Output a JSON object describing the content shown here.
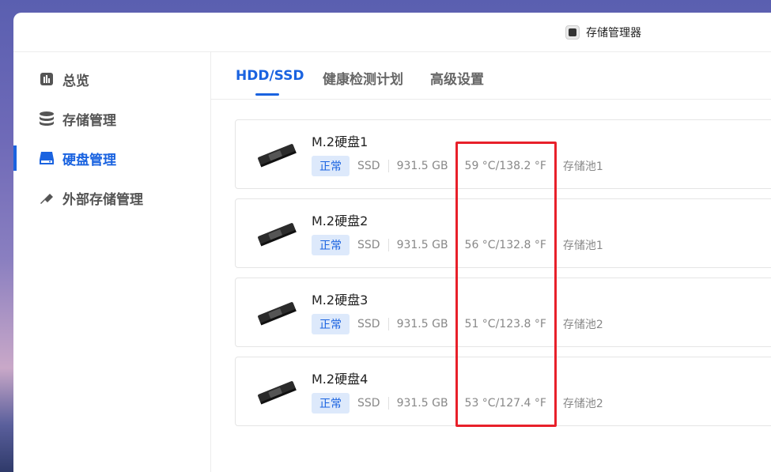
{
  "app": {
    "title": "存储管理器"
  },
  "sidebar": {
    "items": [
      {
        "label": "总览",
        "icon": "chart-icon"
      },
      {
        "label": "存储管理",
        "icon": "database-icon"
      },
      {
        "label": "硬盘管理",
        "icon": "drive-icon",
        "active": true
      },
      {
        "label": "外部存储管理",
        "icon": "usb-icon"
      }
    ]
  },
  "tabs": [
    {
      "label": "HDD/SSD",
      "active": true
    },
    {
      "label": "健康检测计划"
    },
    {
      "label": "高级设置"
    }
  ],
  "disks": [
    {
      "name": "M.2硬盘1",
      "status": "正常",
      "type": "SSD",
      "size": "931.5 GB",
      "temp": "59 °C/138.2 °F",
      "pool": "存储池1"
    },
    {
      "name": "M.2硬盘2",
      "status": "正常",
      "type": "SSD",
      "size": "931.5 GB",
      "temp": "56 °C/132.8 °F",
      "pool": "存储池1"
    },
    {
      "name": "M.2硬盘3",
      "status": "正常",
      "type": "SSD",
      "size": "931.5 GB",
      "temp": "51 °C/123.8 °F",
      "pool": "存储池2"
    },
    {
      "name": "M.2硬盘4",
      "status": "正常",
      "type": "SSD",
      "size": "931.5 GB",
      "temp": "53 °C/127.4 °F",
      "pool": "存储池2"
    }
  ],
  "colors": {
    "accent": "#1a63e0",
    "highlight": "#e8202a",
    "badge_bg": "#dde9fb"
  }
}
